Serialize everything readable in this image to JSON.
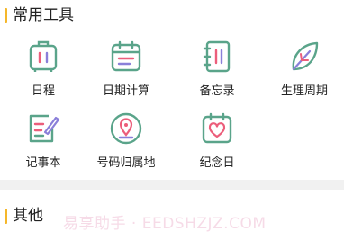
{
  "colors": {
    "accent": "#f5b72a",
    "icon_green": "#5aa48a",
    "icon_pink": "#ec5e7b",
    "icon_purple": "#8a7fd9",
    "divider": "#f1f1f1"
  },
  "sections": [
    {
      "title": "常用工具"
    },
    {
      "title": "其他"
    }
  ],
  "tools": [
    {
      "label": "日程",
      "icon": "luggage-icon"
    },
    {
      "label": "日期计算",
      "icon": "calendar-icon"
    },
    {
      "label": "备忘录",
      "icon": "notebook-icon"
    },
    {
      "label": "生理周期",
      "icon": "leaf-icon"
    },
    {
      "label": "记事本",
      "icon": "note-edit-icon"
    },
    {
      "label": "号码归属地",
      "icon": "location-pin-icon"
    },
    {
      "label": "纪念日",
      "icon": "heart-calendar-icon"
    }
  ],
  "watermark": "易享助手 · EEDSHZJZ.COM"
}
